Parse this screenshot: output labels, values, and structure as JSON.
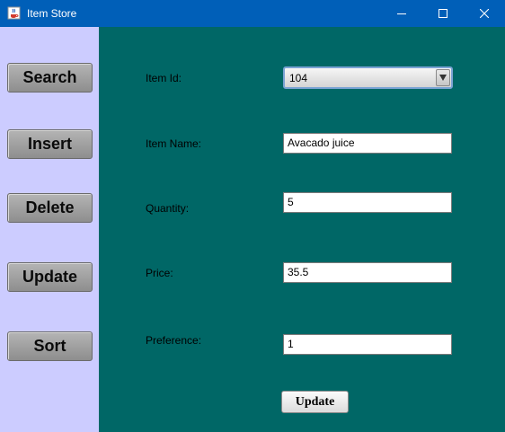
{
  "window": {
    "title": "Item Store",
    "icon": "java-coffee-cup-icon",
    "controls": [
      "minimize-icon",
      "maximize-icon",
      "close-icon"
    ],
    "titlebar_color": "#005fb8"
  },
  "sidebar": {
    "background": "#ccccff",
    "buttons": [
      {
        "label": "Search"
      },
      {
        "label": "Insert"
      },
      {
        "label": "Delete"
      },
      {
        "label": "Update"
      },
      {
        "label": "Sort"
      }
    ]
  },
  "form": {
    "background": "#006766",
    "item_id": {
      "label": "Item Id:",
      "selected": "104"
    },
    "item_name": {
      "label": "Item Name:",
      "value": "Avacado juice"
    },
    "quantity": {
      "label": "Quantity:",
      "value": "5"
    },
    "price": {
      "label": "Price:",
      "value": "35.5"
    },
    "preference": {
      "label": "Preference:",
      "value": "1"
    },
    "submit_label": "Update"
  }
}
